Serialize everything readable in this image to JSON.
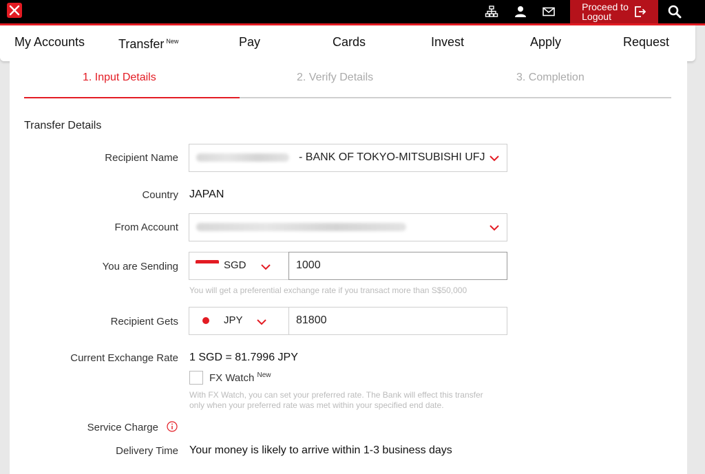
{
  "topbar": {
    "logout_line1": "Proceed to",
    "logout_line2": "Logout",
    "colors": {
      "bar": "#000000",
      "accent": "#e31b23",
      "logout_bg": "#b5121b"
    },
    "icons": [
      "sitemap-icon",
      "user-icon",
      "mail-icon",
      "logout-icon",
      "search-icon"
    ]
  },
  "nav": {
    "items": [
      {
        "label": "My Accounts",
        "badge": ""
      },
      {
        "label": "Transfer",
        "badge": "New"
      },
      {
        "label": "Pay",
        "badge": ""
      },
      {
        "label": "Cards",
        "badge": ""
      },
      {
        "label": "Invest",
        "badge": ""
      },
      {
        "label": "Apply",
        "badge": ""
      },
      {
        "label": "Request",
        "badge": ""
      }
    ]
  },
  "steps": [
    {
      "label": "1. Input Details",
      "active": true
    },
    {
      "label": "2. Verify Details",
      "active": false
    },
    {
      "label": "3. Completion",
      "active": false
    }
  ],
  "form": {
    "section_title": "Transfer Details",
    "recipient_name": {
      "label": "Recipient Name",
      "value": "- BANK OF TOKYO-MITSUBISHI UFJ, L"
    },
    "country": {
      "label": "Country",
      "value": "JAPAN"
    },
    "from_account": {
      "label": "From Account"
    },
    "sending": {
      "label": "You are Sending",
      "currency": "SGD",
      "amount": "1000",
      "hint": "You will get a preferential exchange rate if you transact more than S$50,000"
    },
    "recipient_gets": {
      "label": "Recipient Gets",
      "currency": "JPY",
      "amount": "81800"
    },
    "exchange_rate": {
      "label": "Current Exchange Rate",
      "value": "1 SGD = 81.7996 JPY"
    },
    "fx_watch": {
      "label": "FX Watch",
      "badge": "New",
      "checked": false,
      "hint_line1": "With FX Watch, you can set your preferred rate. The Bank will effect this transfer",
      "hint_line2": "only when your preferred rate was met within your specified end date."
    },
    "service_charge": {
      "label": "Service Charge"
    },
    "delivery_time": {
      "label": "Delivery Time",
      "value": "Your money is likely to arrive within 1-3 business days"
    }
  }
}
